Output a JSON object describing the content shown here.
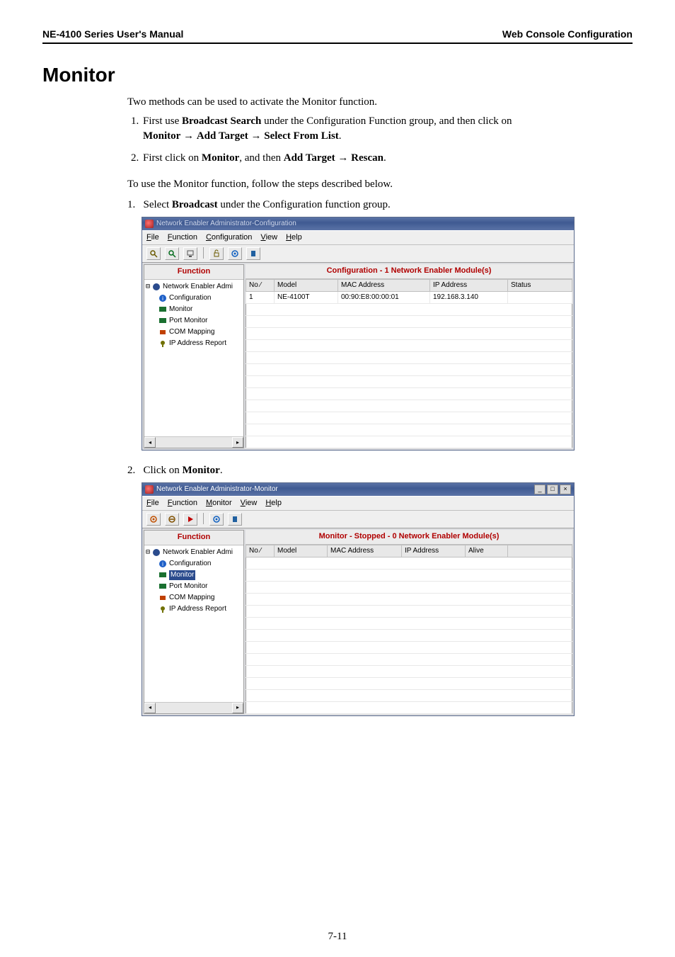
{
  "header": {
    "left": "NE-4100 Series  User's Manual",
    "right": "Web Console  Configuration"
  },
  "section_title": "Monitor",
  "intro": "Two methods can be used to activate the Monitor function.",
  "methods": [
    {
      "line1_a": "First use ",
      "line1_b": "Broadcast Search",
      "line1_c": " under the Configuration Function group, and then click on ",
      "line2_a": "Monitor",
      "line2_b": " → ",
      "line2_c": "Add Target",
      "line2_d": " → ",
      "line2_e": "Select From List",
      "line2_f": "."
    },
    {
      "line1_a": "First click on ",
      "line1_b": "Monitor",
      "line1_c": ", and then ",
      "line1_d": "Add Target",
      "line1_e": " → ",
      "line1_f": "Rescan",
      "line1_g": "."
    }
  ],
  "follow": "To use the Monitor function, follow the steps described below.",
  "steps": {
    "s1_a": "Select ",
    "s1_b": "Broadcast",
    "s1_c": " under the Configuration function group.",
    "s2_a": "Click on ",
    "s2_b": "Monitor",
    "s2_c": "."
  },
  "win1": {
    "title": "Network Enabler Administrator-Configuration",
    "menus": [
      "File",
      "Function",
      "Configuration",
      "View",
      "Help"
    ],
    "menus_u": [
      "F",
      "F",
      "C",
      "V",
      "H"
    ],
    "sidebar_header": "Function",
    "main_header": "Configuration - 1 Network Enabler Module(s)",
    "tree": {
      "root": "Network Enabler Admi",
      "items": [
        "Configuration",
        "Monitor",
        "Port Monitor",
        "COM Mapping",
        "IP Address Report"
      ]
    },
    "table": {
      "headers": [
        "No  ⁄",
        "Model",
        "MAC Address",
        "IP Address",
        "Status"
      ],
      "row": {
        "no": "1",
        "model": "NE-4100T",
        "mac": "00:90:E8:00:00:01",
        "ip": "192.168.3.140",
        "status": ""
      }
    }
  },
  "win2": {
    "title": "Network Enabler Administrator-Monitor",
    "menus": [
      "File",
      "Function",
      "Monitor",
      "View",
      "Help"
    ],
    "menus_u": [
      "F",
      "F",
      "M",
      "V",
      "H"
    ],
    "sidebar_header": "Function",
    "main_header": "Monitor - Stopped - 0 Network Enabler Module(s)",
    "tree": {
      "root": "Network Enabler Admi",
      "items": [
        "Configuration",
        "Monitor",
        "Port Monitor",
        "COM Mapping",
        "IP Address Report"
      ]
    },
    "table": {
      "headers": [
        "No  ⁄",
        "Model",
        "MAC Address",
        "IP Address",
        "Alive",
        " "
      ]
    }
  },
  "page_number": "7-11"
}
